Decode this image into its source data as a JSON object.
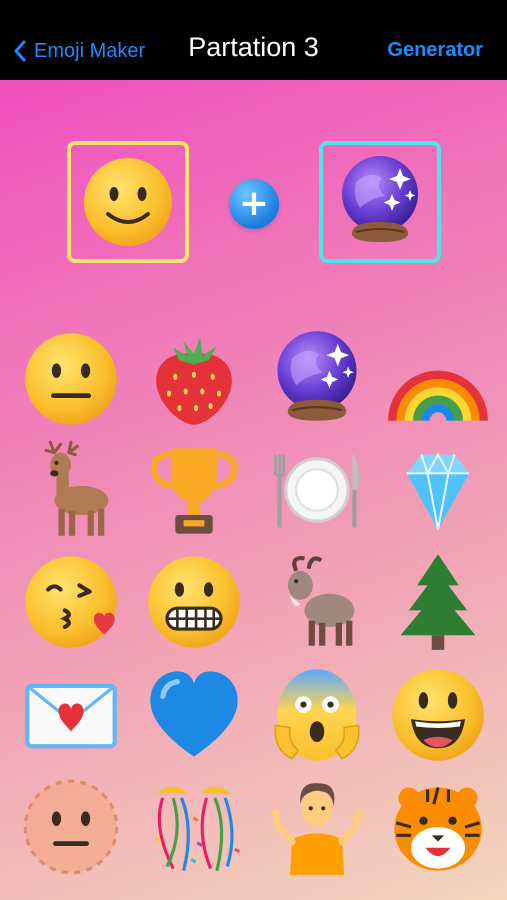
{
  "nav": {
    "back_label": "Emoji Maker",
    "title": "Partation 3",
    "action_label": "Generator"
  },
  "selection": {
    "left": "slightly-smiling-face",
    "right": "crystal-ball"
  },
  "grid": [
    [
      "neutral-face",
      "strawberry",
      "crystal-ball",
      "rainbow"
    ],
    [
      "deer",
      "trophy",
      "fork-knife-plate",
      "gem"
    ],
    [
      "kissing-heart-face",
      "grimacing-face",
      "goat",
      "evergreen-tree"
    ],
    [
      "love-letter",
      "blue-heart",
      "screaming-face",
      "grinning-face"
    ],
    [
      "dotted-line-face",
      "confetti-ball",
      "person-shrugging",
      "tiger-face"
    ]
  ],
  "colors": {
    "accent": "#1a8cff",
    "slot_left_border": "#f7e56b",
    "slot_right_border": "#4ee4e8",
    "gradient_start": "#f04fbf",
    "gradient_end": "#f3d6bd"
  }
}
